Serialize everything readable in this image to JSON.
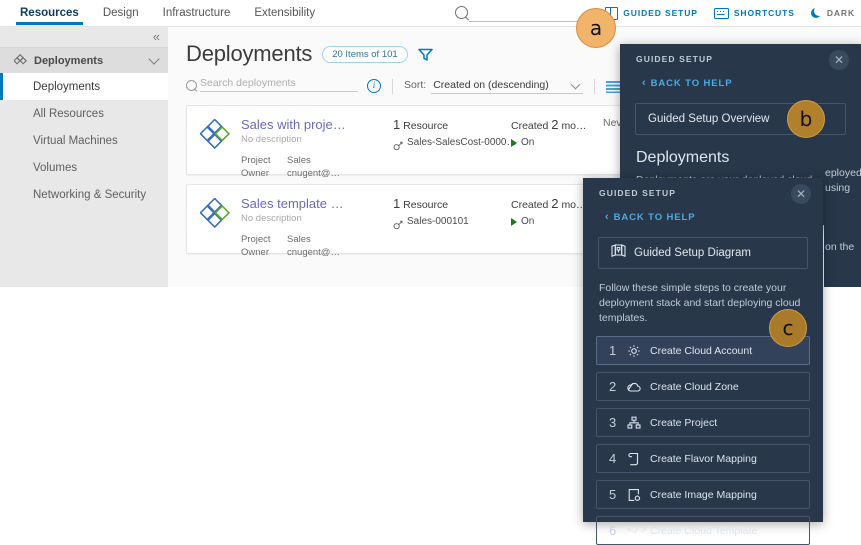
{
  "topnav": {
    "tabs": [
      {
        "label": "Resources",
        "active": true
      },
      {
        "label": "Design",
        "active": false
      },
      {
        "label": "Infrastructure",
        "active": false
      },
      {
        "label": "Extensibility",
        "active": false
      }
    ],
    "search_placeholder": "",
    "guided_setup_label": "GUIDED SETUP",
    "shortcuts_label": "SHORTCUTS",
    "dark_label": "DARK"
  },
  "sidebar": {
    "group_label": "Deployments",
    "items": [
      {
        "label": "Deployments",
        "selected": true
      },
      {
        "label": "All Resources",
        "selected": false
      },
      {
        "label": "Virtual Machines",
        "selected": false
      },
      {
        "label": "Volumes",
        "selected": false
      },
      {
        "label": "Networking & Security",
        "selected": false
      }
    ]
  },
  "main": {
    "page_title": "Deployments",
    "count_pill": "20 Items of 101",
    "search_placeholder": "Search deployments",
    "search_value": "",
    "sort_label": "Sort:",
    "sort_value": "Created on (descending)"
  },
  "cards": [
    {
      "name": "Sales with proje…",
      "description": "No description",
      "project_key": "Project",
      "project_value": "Sales",
      "owner_key": "Owner",
      "owner_value": "cnugent@…",
      "resource_count": "1",
      "resource_label": "Resource",
      "resource_name": "Sales-SalesCost-0000…",
      "created_prefix": "Created",
      "created_value": "2",
      "created_suffix": "mo…",
      "status": "On",
      "expiry": "Never exp"
    },
    {
      "name": "Sales template …",
      "description": "No description",
      "project_key": "Project",
      "project_value": "Sales",
      "owner_key": "Owner",
      "owner_value": "cnugent@…",
      "resource_count": "1",
      "resource_label": "Resource",
      "resource_name": "Sales-000101",
      "created_prefix": "Created",
      "created_value": "2",
      "created_suffix": "mo…",
      "status": "On",
      "expiry": ""
    }
  ],
  "guided_setup_b": {
    "header": "GUIDED SETUP",
    "back_label": "BACK TO HELP",
    "overview_label": "Guided Setup Overview",
    "heading": "Deployments",
    "body": "Deployments are your deployed cloud",
    "body_tail_1": "eployed",
    "body_tail_2": "using",
    "body_tail_3": "on the"
  },
  "guided_setup_c": {
    "header": "GUIDED SETUP",
    "back_label": "BACK TO HELP",
    "diagram_label": "Guided Setup Diagram",
    "intro": "Follow these simple steps to create your deployment stack and start deploying cloud templates.",
    "steps": [
      {
        "num": "1",
        "label": "Create Cloud Account",
        "icon": "gear-icon",
        "highlighted": true
      },
      {
        "num": "2",
        "label": "Create Cloud Zone",
        "icon": "cloud-icon",
        "highlighted": false
      },
      {
        "num": "3",
        "label": "Create Project",
        "icon": "org-chart-icon",
        "highlighted": false
      },
      {
        "num": "4",
        "label": "Create Flavor Mapping",
        "icon": "scroll-icon",
        "highlighted": false
      },
      {
        "num": "5",
        "label": "Create Image Mapping",
        "icon": "image-gear-icon",
        "highlighted": false
      },
      {
        "num": "6",
        "label": "Create Cloud Template",
        "icon": "code-icon",
        "highlighted": false
      }
    ]
  },
  "annotations": [
    {
      "label": "a",
      "color": "#f2b36a"
    },
    {
      "label": "b",
      "color": "#b0802c"
    },
    {
      "label": "c",
      "color": "#a87a2a"
    }
  ]
}
